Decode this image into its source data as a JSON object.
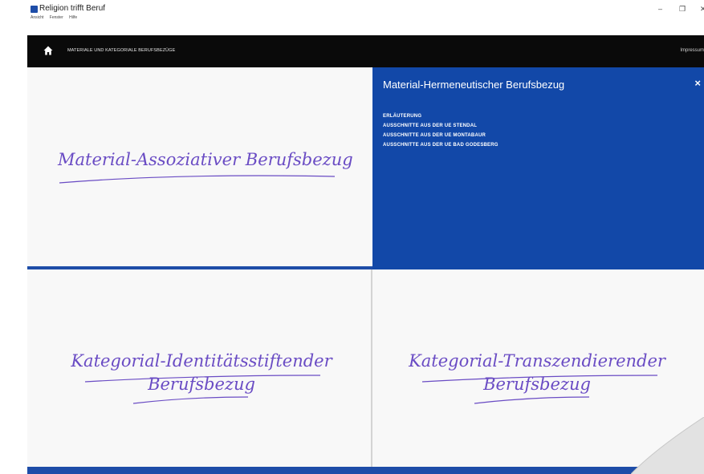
{
  "window": {
    "title": "Religion trifft Beruf",
    "menu": [
      "Ansicht",
      "Fenster",
      "Hilfe"
    ],
    "controls": {
      "minimize": "–",
      "maximize": "❐",
      "close": "✕"
    }
  },
  "navbar": {
    "title": "MATERIALE UND KATEGORIALE BERUFSBEZÜGE",
    "impressum": "Impressum"
  },
  "tiles": {
    "top_left": {
      "line1": "Material-Assoziativer Berufsbezug"
    },
    "bottom_left": {
      "line1": "Kategorial-Identitätsstiftender",
      "line2": "Berufsbezug"
    },
    "bottom_right": {
      "line1": "Kategorial-Transzendierender",
      "line2": "Berufsbezug"
    }
  },
  "panel": {
    "title": "Material-Hermeneutischer Berufsbezug",
    "close": "×",
    "links": [
      "ERLÄUTERUNG",
      "AUSSCHNITTE AUS DER UE STENDAL",
      "AUSSCHNITTE AUS DER UE MONTABAUR",
      "AUSSCHNITTE AUS DER UE BAD GODESBERG"
    ]
  },
  "colors": {
    "accent_blue": "#1248a8",
    "navbar": "#0a0a0a",
    "handwriting": "#6a4cc4"
  }
}
